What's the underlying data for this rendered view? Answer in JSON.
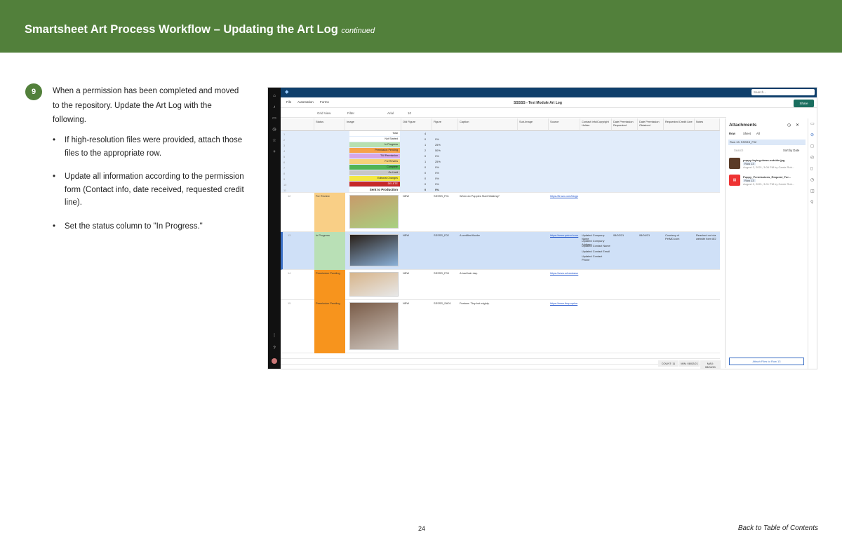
{
  "header": {
    "title": "Smartsheet Art Process Workflow – Updating the Art Log",
    "title_suffix": "continued"
  },
  "step": {
    "number": "9",
    "intro": "When a permission has been completed and moved to the repository. Update the Art Log with the following.",
    "bullets": [
      "If high-resolution files were provided, attach those files to the appropriate row.",
      "Update all information according to the permission form (Contact info, date received, requested credit line).",
      "Set the status column to \"In Progress.\""
    ]
  },
  "screenshot": {
    "search_placeholder": "Search...",
    "menu": [
      "File",
      "Automation",
      "Forms"
    ],
    "sheet_title": "SSSSS - Test Module Art Log",
    "share_label": "Share",
    "toolbar": {
      "view": "Grid View",
      "filter": "Filter",
      "font": "Arial",
      "size": "10"
    },
    "columns": [
      "Status",
      "Image",
      "Old Figure",
      "Figure",
      "Caption",
      "Sub-Image",
      "Source",
      "Contact Info/Copyright Holder",
      "Date Permission Requested",
      "Date Permission Obtained",
      "Requested Credit Line",
      "Notes"
    ],
    "summary": [
      {
        "label": "Total",
        "count": "4",
        "pct": ""
      },
      {
        "label": "Not Started",
        "count": "0",
        "pct": "0%"
      },
      {
        "label": "In Progress",
        "count": "1",
        "pct": "25%"
      },
      {
        "label": "Permission Pending",
        "count": "2",
        "pct": "50%"
      },
      {
        "label": "TW Permission",
        "count": "0",
        "pct": "0%"
      },
      {
        "label": "For Review",
        "count": "1",
        "pct": "25%"
      },
      {
        "label": "Complete",
        "count": "0",
        "pct": "0%"
      },
      {
        "label": "On Hold",
        "count": "0",
        "pct": "0%"
      },
      {
        "label": "Editorial Changes",
        "count": "0",
        "pct": "0%"
      },
      {
        "label": "DELETE",
        "count": "0",
        "pct": "0%"
      },
      {
        "label": "Sent to Production",
        "count": "0",
        "pct": "0%"
      }
    ],
    "summary_colors": [
      "#ffffff",
      "#ffffff",
      "#b7e0b0",
      "#f6a24a",
      "#d6a6e8",
      "#f7d27a",
      "#52b455",
      "#c7c7c7",
      "#f4e842",
      "#c62828",
      "#ffffff"
    ],
    "rows": [
      {
        "num": "12",
        "status": "For Review",
        "status_color": "#f9cf86",
        "old": "NEW",
        "figure": "SSSSS_F01",
        "caption": "When do Puppies Start Walking?",
        "source": "https://lirozo.com/blogs",
        "contact": [],
        "req": "",
        "obt": "",
        "credit": "",
        "notes": ""
      },
      {
        "num": "13",
        "status": "In Progress",
        "status_color": "#b9e0b6",
        "old": "NEW",
        "figure": "SSSSS_F02",
        "caption": "A certified floofer",
        "source": "https://www.petmd.com",
        "contact": [
          "Updated Company Name",
          "Updated Company Address",
          "Updated Contact Name",
          "Updated Contact Email",
          "Updated Contact Phone"
        ],
        "req": "08/02/21",
        "obt": "08/04/21",
        "credit": "Courtesy of PetMD.com",
        "notes": "Reached out via website form 8/2"
      },
      {
        "num": "14",
        "status": "Permission Pending",
        "status_color": "#f7941d",
        "old": "NEW",
        "figure": "SSSSS_F03",
        "caption": "A bad hair day.",
        "source": "https://www.urbandawn",
        "contact": [],
        "req": "",
        "obt": "",
        "credit": "",
        "notes": ""
      },
      {
        "num": "15",
        "status": "Permission Pending",
        "status_color": "#f7941d",
        "old": "NEW",
        "figure": "SSSSS_SA01",
        "caption": "Feature: Tiny but mighty.",
        "source": "https://www.thepuprise",
        "contact": [],
        "req": "",
        "obt": "",
        "credit": "",
        "notes": ""
      }
    ],
    "footer_stats": [
      "COUNT: 11",
      "MIN: 08/02/21",
      "MAX: 08/04/21"
    ],
    "attachments": {
      "title": "Attachments",
      "tabs": [
        "Row",
        "Sheet",
        "All"
      ],
      "search": "Search",
      "sort": "Sort by Date",
      "subheader": "Row 13: SSSSS_F02",
      "items": [
        {
          "name": "puppy-laying-down-outside.jpg",
          "badge": "Row 13",
          "meta": "August 2, 2021, 3:06 PM by Carrie Rob..."
        },
        {
          "name": "Puppy_Permissions_Request_For...",
          "badge": "Row 13",
          "meta": "August 2, 2021, 3:01 PM by Carrie Rob..."
        }
      ],
      "button": "Attach Files to Row 13"
    }
  },
  "footer": {
    "page_number": "24",
    "back_link": "Back to Table of Contents"
  }
}
